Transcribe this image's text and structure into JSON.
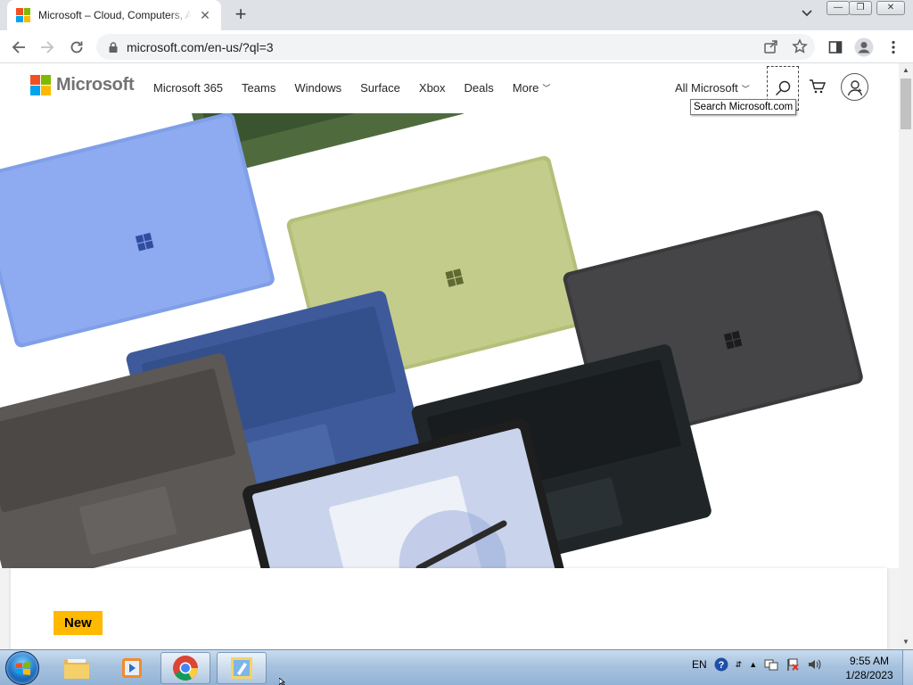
{
  "browser": {
    "tab": {
      "title": "Microsoft – Cloud, Computers, Apps & Gaming"
    },
    "address": {
      "url": "microsoft.com/en-us/?ql=3"
    }
  },
  "site": {
    "logo_text": "Microsoft",
    "nav": [
      {
        "label": "Microsoft 365"
      },
      {
        "label": "Teams"
      },
      {
        "label": "Windows"
      },
      {
        "label": "Surface"
      },
      {
        "label": "Xbox"
      },
      {
        "label": "Deals"
      },
      {
        "label": "More"
      }
    ],
    "all_microsoft": "All Microsoft",
    "search_tooltip": "Search Microsoft.com",
    "badge": "New"
  },
  "taskbar": {
    "language": "EN",
    "time": "9:55 AM",
    "date": "1/28/2023"
  },
  "colors": {
    "ms_red": "#f25022",
    "ms_green": "#7fba00",
    "ms_blue": "#00a4ef",
    "ms_yellow": "#ffb900",
    "badge": "#ffb900"
  },
  "icons": [
    "back-arrow-icon",
    "forward-arrow-icon",
    "reload-icon",
    "lock-icon",
    "share-icon",
    "star-icon",
    "sidebar-icon",
    "profile-icon",
    "kebab-menu-icon",
    "search-icon",
    "cart-icon",
    "account-icon"
  ]
}
